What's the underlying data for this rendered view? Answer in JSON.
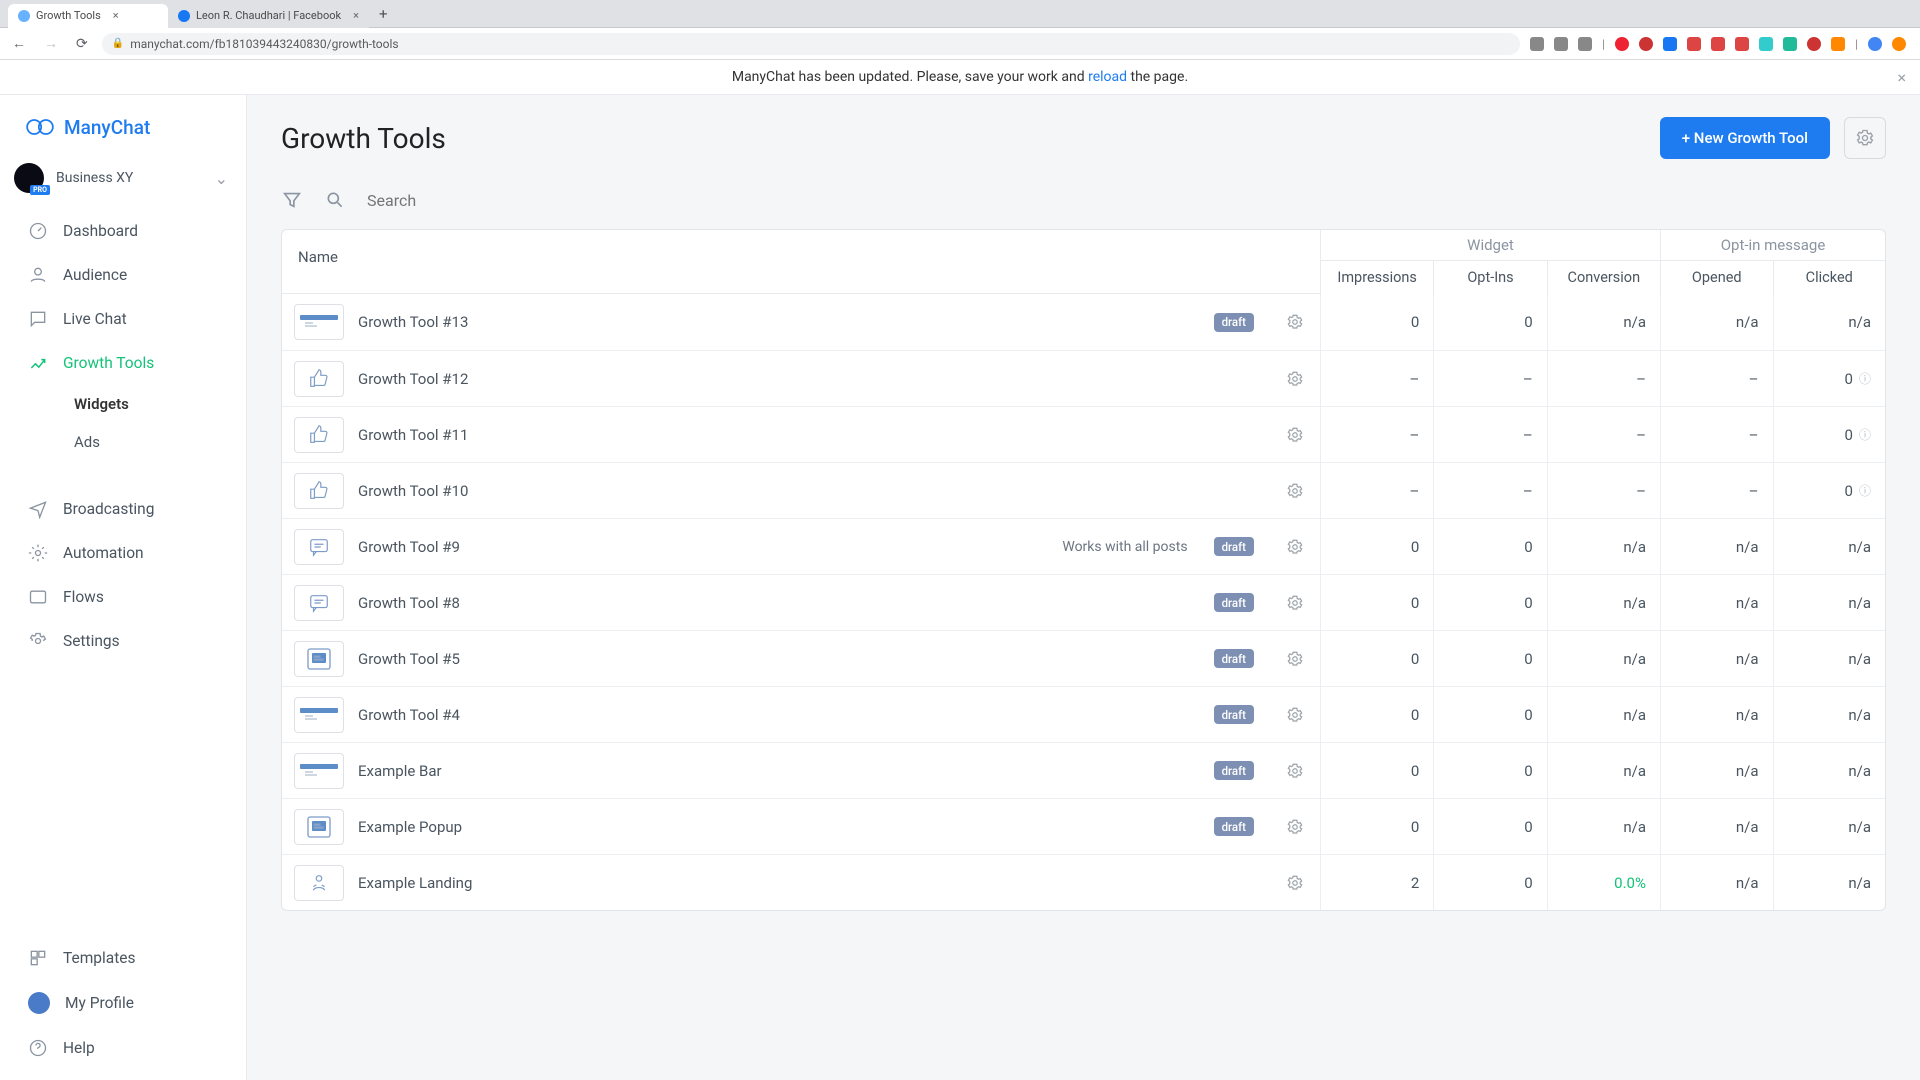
{
  "browser": {
    "tabs": [
      {
        "title": "Growth Tools",
        "active": true
      },
      {
        "title": "Leon R. Chaudhari | Facebook",
        "active": false
      }
    ],
    "url": "manychat.com/fb181039443240830/growth-tools"
  },
  "banner": {
    "prefix": "ManyChat has been updated. Please, save your work and ",
    "link": "reload",
    "suffix": " the page."
  },
  "brand": "ManyChat",
  "account": {
    "name": "Business XY"
  },
  "sidebar": {
    "items": [
      {
        "label": "Dashboard"
      },
      {
        "label": "Audience"
      },
      {
        "label": "Live Chat"
      },
      {
        "label": "Growth Tools",
        "active": true,
        "children": [
          {
            "label": "Widgets",
            "active": true
          },
          {
            "label": "Ads"
          }
        ]
      },
      {
        "label": "Broadcasting"
      },
      {
        "label": "Automation"
      },
      {
        "label": "Flows"
      },
      {
        "label": "Settings"
      }
    ],
    "lower": [
      {
        "label": "Templates"
      },
      {
        "label": "My Profile"
      },
      {
        "label": "Help"
      }
    ]
  },
  "page": {
    "title": "Growth Tools",
    "new_button": "+ New Growth Tool",
    "search_placeholder": "Search"
  },
  "table": {
    "headers": {
      "name": "Name",
      "widget_group": "Widget",
      "widget_cols": [
        "Impressions",
        "Opt-Ins",
        "Conversion"
      ],
      "optin_group": "Opt-in message",
      "optin_cols": [
        "Opened",
        "Clicked"
      ]
    },
    "rows": [
      {
        "icon": "bar",
        "name": "Growth Tool #13",
        "badge": "draft",
        "impressions": "0",
        "optins": "0",
        "conversion": "n/a",
        "opened": "n/a",
        "clicked": "n/a"
      },
      {
        "icon": "thumb",
        "name": "Growth Tool #12",
        "impressions": "–",
        "optins": "–",
        "conversion": "–",
        "opened": "–",
        "clicked": "0",
        "help": true
      },
      {
        "icon": "thumb",
        "name": "Growth Tool #11",
        "impressions": "–",
        "optins": "–",
        "conversion": "–",
        "opened": "–",
        "clicked": "0",
        "help": true
      },
      {
        "icon": "thumb",
        "name": "Growth Tool #10",
        "impressions": "–",
        "optins": "–",
        "conversion": "–",
        "opened": "–",
        "clicked": "0",
        "help": true
      },
      {
        "icon": "comment",
        "name": "Growth Tool #9",
        "extra": "Works with all posts",
        "badge": "draft",
        "impressions": "0",
        "optins": "0",
        "conversion": "n/a",
        "opened": "n/a",
        "clicked": "n/a"
      },
      {
        "icon": "comment",
        "name": "Growth Tool #8",
        "badge": "draft",
        "impressions": "0",
        "optins": "0",
        "conversion": "n/a",
        "opened": "n/a",
        "clicked": "n/a"
      },
      {
        "icon": "popup",
        "name": "Growth Tool #5",
        "badge": "draft",
        "impressions": "0",
        "optins": "0",
        "conversion": "n/a",
        "opened": "n/a",
        "clicked": "n/a"
      },
      {
        "icon": "bar",
        "name": "Growth Tool #4",
        "badge": "draft",
        "impressions": "0",
        "optins": "0",
        "conversion": "n/a",
        "opened": "n/a",
        "clicked": "n/a"
      },
      {
        "icon": "bar",
        "name": "Example Bar",
        "badge": "draft",
        "impressions": "0",
        "optins": "0",
        "conversion": "n/a",
        "opened": "n/a",
        "clicked": "n/a"
      },
      {
        "icon": "popup",
        "name": "Example Popup",
        "badge": "draft",
        "impressions": "0",
        "optins": "0",
        "conversion": "n/a",
        "opened": "n/a",
        "clicked": "n/a"
      },
      {
        "icon": "landing",
        "name": "Example Landing",
        "impressions": "2",
        "optins": "0",
        "conversion": "0.0%",
        "conv_green": true,
        "opened": "n/a",
        "clicked": "n/a"
      }
    ]
  }
}
